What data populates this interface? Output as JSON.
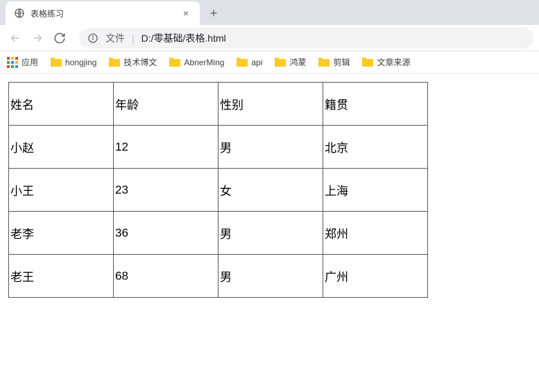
{
  "tab": {
    "title": "表格练习",
    "close": "×",
    "new": "+"
  },
  "address": {
    "prefix": "文件",
    "divider": "|",
    "path": "D:/零基础/表格.html"
  },
  "bookmarks": {
    "apps": "应用",
    "items": [
      "hongjing",
      "技术博文",
      "AbnerMing",
      "api",
      "鸿蒙",
      "剪辑",
      "文章来源"
    ]
  },
  "table": {
    "headers": [
      "姓名",
      "年龄",
      "性别",
      "籍贯"
    ],
    "rows": [
      [
        "小赵",
        "12",
        "男",
        "北京"
      ],
      [
        "小王",
        "23",
        "女",
        "上海"
      ],
      [
        "老李",
        "36",
        "男",
        "郑州"
      ],
      [
        "老王",
        "68",
        "男",
        "广州"
      ]
    ]
  }
}
